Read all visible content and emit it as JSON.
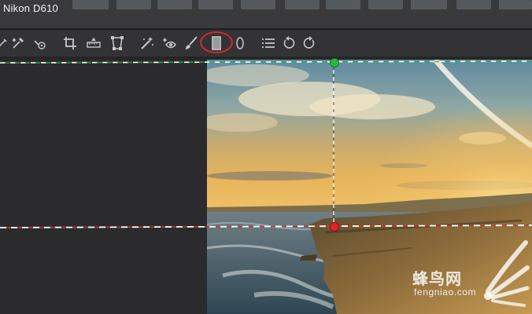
{
  "header": {
    "camera_model": "Nikon D610"
  },
  "toolbar": {
    "tools": [
      {
        "name": "partial-eyedropper-icon"
      },
      {
        "name": "eyedropper-icon"
      },
      {
        "name": "spot-picker-icon"
      },
      {
        "name": "crop-icon"
      },
      {
        "name": "straighten-icon"
      },
      {
        "name": "transform-icon"
      },
      {
        "name": "auto-retouch-icon"
      },
      {
        "name": "red-eye-icon"
      },
      {
        "name": "brush-icon"
      },
      {
        "name": "gradient-mask-icon",
        "highlighted": true
      },
      {
        "name": "radial-mask-icon"
      },
      {
        "name": "list-icon"
      },
      {
        "name": "rotate-left-icon"
      },
      {
        "name": "rotate-right-icon"
      }
    ],
    "highlight_color": "#d42a2a"
  },
  "overlay": {
    "top_handle_color": "#2fb43c",
    "bottom_handle_color": "#e0242a",
    "top_line_color": "#2fb43c",
    "bottom_line_color": "#c23a2e"
  },
  "watermark": {
    "cn": "蜂鸟网",
    "en": "fengniao.com"
  }
}
